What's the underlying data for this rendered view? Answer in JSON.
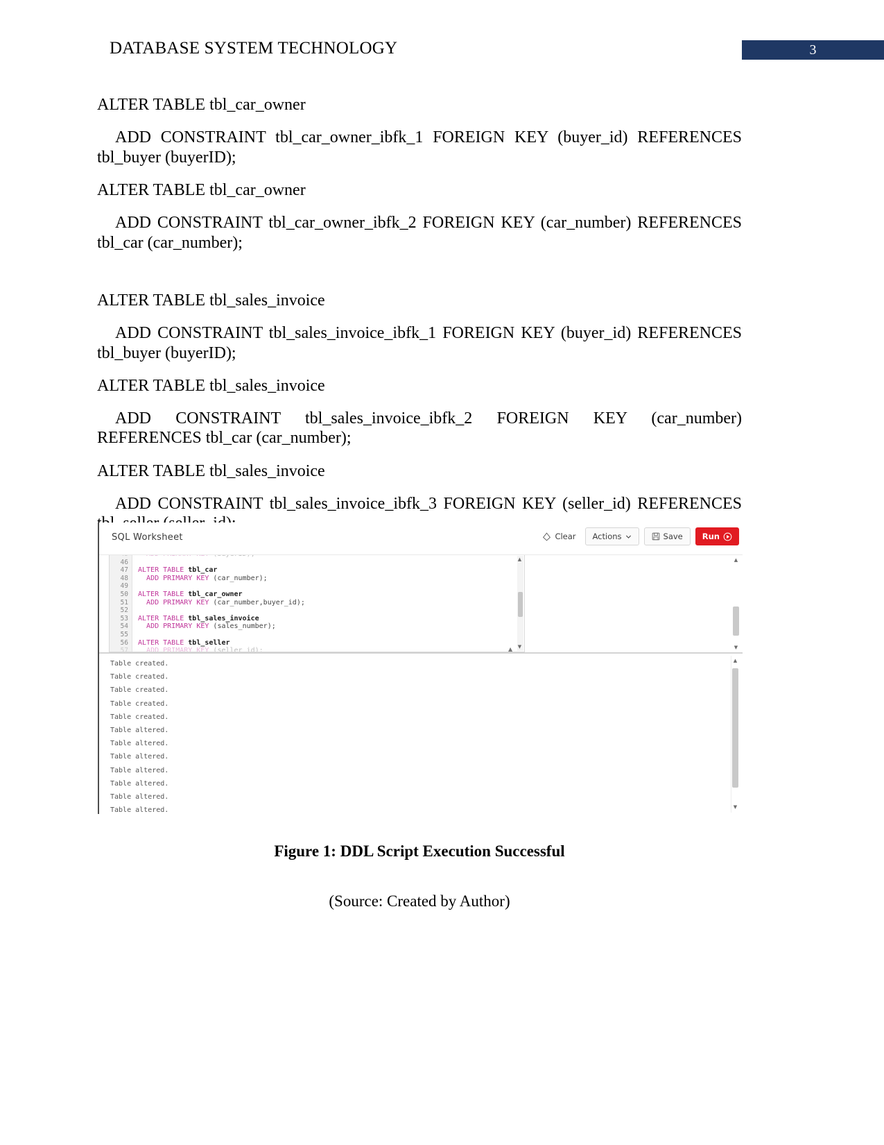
{
  "header": {
    "title": "DATABASE SYSTEM TECHNOLOGY",
    "page_number": "3",
    "badge_color": "#1f3864"
  },
  "body_paragraphs": [
    {
      "id": "p1",
      "text": "ALTER TABLE tbl_car_owner"
    },
    {
      "id": "p2",
      "text": "ADD CONSTRAINT tbl_car_owner_ibfk_1 FOREIGN KEY (buyer_id) REFERENCES tbl_buyer (buyerID);"
    },
    {
      "id": "p3",
      "text": "ALTER TABLE tbl_car_owner"
    },
    {
      "id": "p4",
      "text": "ADD CONSTRAINT tbl_car_owner_ibfk_2 FOREIGN KEY (car_number) REFERENCES tbl_car (car_number);"
    },
    {
      "id": "p5",
      "text": "ALTER TABLE tbl_sales_invoice"
    },
    {
      "id": "p6",
      "text": "ADD CONSTRAINT tbl_sales_invoice_ibfk_1 FOREIGN KEY (buyer_id) REFERENCES tbl_buyer (buyerID);"
    },
    {
      "id": "p7",
      "text": "ALTER TABLE tbl_sales_invoice"
    },
    {
      "id": "p8",
      "text": "ADD CONSTRAINT tbl_sales_invoice_ibfk_2 FOREIGN KEY (car_number) REFERENCES tbl_car (car_number);"
    },
    {
      "id": "p9",
      "text": "ALTER TABLE tbl_sales_invoice"
    },
    {
      "id": "p10",
      "text": "ADD CONSTRAINT tbl_sales_invoice_ibfk_3 FOREIGN KEY (seller_id) REFERENCES tbl_seller (seller_id);"
    }
  ],
  "worksheet": {
    "title": "SQL Worksheet",
    "toolbar": {
      "clear_label": "Clear",
      "clear_icon": "eraser-icon",
      "actions_label": "Actions",
      "actions_caret": "⌄",
      "save_label": "Save",
      "save_icon": "floppy-disk-icon",
      "run_label": "Run",
      "run_icon": "play-circle-icon",
      "run_color": "#e11b22"
    },
    "editor": {
      "lines": [
        {
          "num": "45",
          "text": "  ADD PRIMARY KEY (buyerID);",
          "partial": true
        },
        {
          "num": "46",
          "text": ""
        },
        {
          "num": "47",
          "text": "ALTER TABLE tbl_car"
        },
        {
          "num": "48",
          "text": "  ADD PRIMARY KEY (car_number);"
        },
        {
          "num": "49",
          "text": ""
        },
        {
          "num": "50",
          "text": "ALTER TABLE tbl_car_owner"
        },
        {
          "num": "51",
          "text": "  ADD PRIMARY KEY (car_number,buyer_id);"
        },
        {
          "num": "52",
          "text": ""
        },
        {
          "num": "53",
          "text": "ALTER TABLE tbl_sales_invoice"
        },
        {
          "num": "54",
          "text": "  ADD PRIMARY KEY (sales_number);"
        },
        {
          "num": "55",
          "text": ""
        },
        {
          "num": "56",
          "text": "ALTER TABLE tbl_seller"
        },
        {
          "num": "57",
          "text": "  ADD PRIMARY KEY (seller_id);",
          "partial": true
        }
      ],
      "scroll_up_arrow": "▲",
      "scroll_down_arrow": "▼",
      "hscroll_arrow": "▲"
    },
    "output": {
      "lines": [
        "Table created.",
        "Table created.",
        "Table created.",
        "Table created.",
        "Table created.",
        "Table altered.",
        "Table altered.",
        "Table altered.",
        "Table altered.",
        "Table altered.",
        "Table altered.",
        "Table altered."
      ],
      "scroll_up_arrow": "▲",
      "scroll_down_arrow": "▼"
    }
  },
  "figure": {
    "caption": "Figure 1: DDL Script Execution Successful",
    "source": "(Source: Created by Author)"
  }
}
